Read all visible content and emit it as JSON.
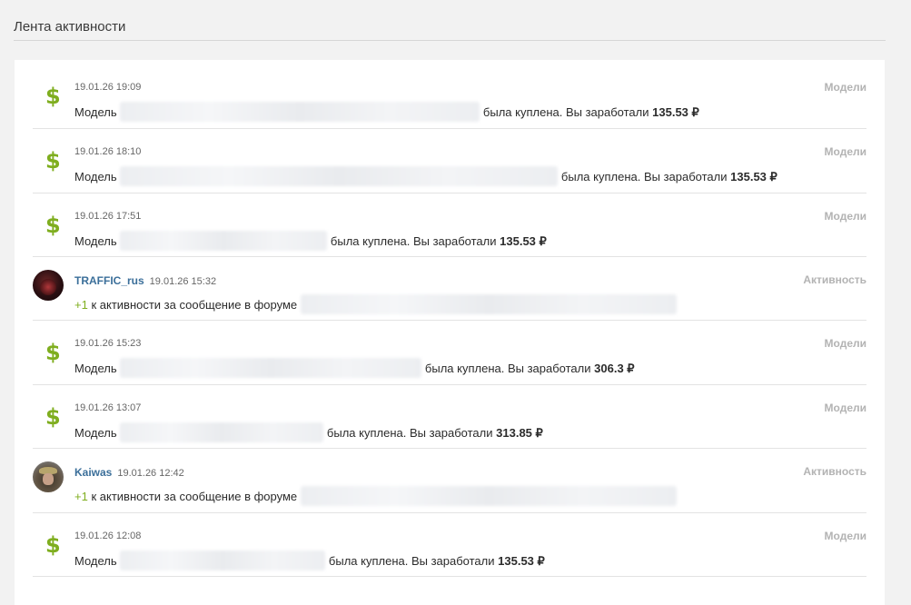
{
  "header": {
    "title": "Лента активности"
  },
  "colors": {
    "accent_green": "#7fae1f",
    "user_blue": "#3b6f9a",
    "category_gray": "#b3b3b3"
  },
  "feed": [
    {
      "type": "model",
      "icon": "dollar-icon",
      "icon_glyph": "$",
      "time": "19.01.26 19:09",
      "prefix": "Модель",
      "text": "была куплена. Вы заработали",
      "amount": "135.53 ₽",
      "category": "Модели"
    },
    {
      "type": "model",
      "icon": "dollar-icon",
      "icon_glyph": "$",
      "time": "19.01.26 18:10",
      "prefix": "Модель",
      "text": "была куплена. Вы заработали",
      "amount": "135.53 ₽",
      "category": "Модели"
    },
    {
      "type": "model",
      "icon": "dollar-icon",
      "icon_glyph": "$",
      "time": "19.01.26 17:51",
      "prefix": "Модель",
      "text": "была куплена. Вы заработали",
      "amount": "135.53 ₽",
      "category": "Модели"
    },
    {
      "type": "activity",
      "user": "TRAFFIC_rus",
      "time": "19.01.26 15:32",
      "plus": "+1",
      "text": "к активности за сообщение в форуме",
      "category": "Активность"
    },
    {
      "type": "model",
      "icon": "dollar-icon",
      "icon_glyph": "$",
      "time": "19.01.26 15:23",
      "prefix": "Модель",
      "text": "была куплена. Вы заработали",
      "amount": "306.3 ₽",
      "category": "Модели"
    },
    {
      "type": "model",
      "icon": "dollar-icon",
      "icon_glyph": "$",
      "time": "19.01.26 13:07",
      "prefix": "Модель",
      "text": "была куплена. Вы заработали",
      "amount": "313.85 ₽",
      "category": "Модели"
    },
    {
      "type": "activity",
      "user": "Kaiwas",
      "time": "19.01.26 12:42",
      "plus": "+1",
      "text": "к активности за сообщение в форуме",
      "category": "Активность"
    },
    {
      "type": "model",
      "icon": "dollar-icon",
      "icon_glyph": "$",
      "time": "19.01.26 12:08",
      "prefix": "Модель",
      "text": "была куплена. Вы заработали",
      "amount": "135.53 ₽",
      "category": "Модели"
    }
  ]
}
